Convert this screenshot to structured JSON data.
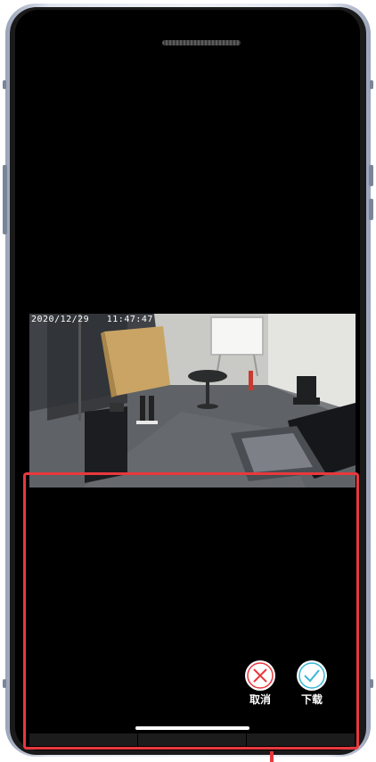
{
  "video": {
    "timestamp": "2020/12/29   11:47:47"
  },
  "actions": {
    "cancel_label": "取消",
    "download_label": "下载"
  },
  "colors": {
    "highlight": "#e8383d",
    "cancel_icon": "#e8383d",
    "download_icon": "#3ab6d6",
    "screen_background": "#000000"
  },
  "icons": {
    "cancel": "close-x-icon",
    "download": "checkmark-icon"
  }
}
